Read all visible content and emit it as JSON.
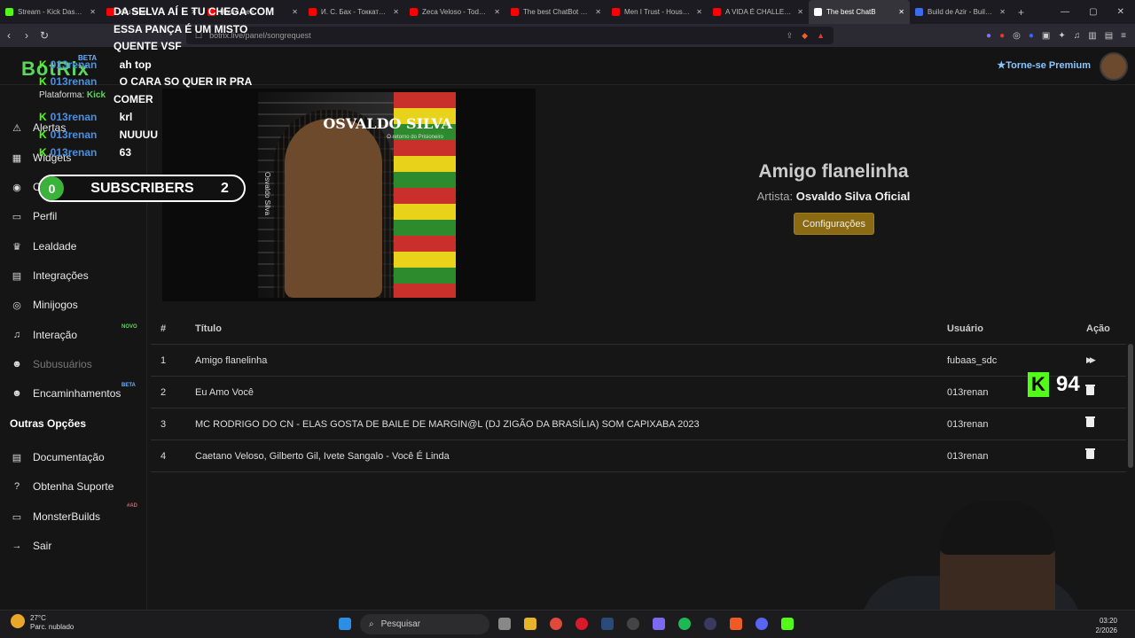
{
  "browser": {
    "tabs": [
      {
        "label": "Stream - Kick Dashbo",
        "color": "#53fc18"
      },
      {
        "label": "YouTube",
        "color": "#ff0000"
      },
      {
        "label": "Hours Dee",
        "color": "#ff0000"
      },
      {
        "label": "И. С. Бах - Токката и ф",
        "color": "#ff0000"
      },
      {
        "label": "Zeca Veloso - Todo Ho",
        "color": "#ff0000"
      },
      {
        "label": "The best ChatBot and",
        "color": "#ff0000"
      },
      {
        "label": "Men I Trust - House Ed",
        "color": "#ff0000"
      },
      {
        "label": "A VIDA É CHALLENGE",
        "color": "#ff0000"
      },
      {
        "label": "The best ChatB",
        "color": "#ffffff",
        "active": true
      },
      {
        "label": "Build de Azir - Builds c",
        "color": "#3b6cf0"
      }
    ],
    "url": "botrix.live/panel/songrequest"
  },
  "header": {
    "logo": "BotRix",
    "logo_badge": "BETA",
    "premium": "Torne-se Premium"
  },
  "sidebar": {
    "platform_label": "Plataforma:",
    "platform_value": "Kick",
    "items": [
      {
        "label": "Alertas",
        "icon": "warning-icon"
      },
      {
        "label": "Widgets",
        "icon": "widgets-icon"
      },
      {
        "label": "Comandos",
        "icon": "robot-icon"
      },
      {
        "label": "Perfil",
        "icon": "profile-icon"
      },
      {
        "label": "Lealdade",
        "icon": "trophy-icon"
      },
      {
        "label": "Integrações",
        "icon": "integrations-icon"
      },
      {
        "label": "Minijogos",
        "icon": "gamepad-icon"
      },
      {
        "label": "Interação",
        "icon": "music-icon",
        "badge": "NOVO"
      },
      {
        "label": "Subusuários",
        "icon": "users-icon",
        "disabled": true
      },
      {
        "label": "Encaminhamentos",
        "icon": "group-icon",
        "badge": "BETA"
      }
    ],
    "section_label": "Outras Opções",
    "other_items": [
      {
        "label": "Documentação",
        "icon": "docs-icon"
      },
      {
        "label": "Obtenha Suporte",
        "icon": "support-icon"
      },
      {
        "label": "MonsterBuilds",
        "icon": "monitor-icon",
        "badge": "#AD"
      },
      {
        "label": "Sair",
        "icon": "logout-icon"
      }
    ]
  },
  "now_playing": {
    "title": "Amigo flanelinha",
    "artist_label": "Artista:",
    "artist": "Osvaldo Silva Oficial",
    "config_button": "Configurações",
    "cover_artist": "OSVALDO SILVA",
    "cover_album": "O retorno do Prisioneiro",
    "cover_vertical": "Osvaldo Silva"
  },
  "queue": {
    "headers": {
      "num": "#",
      "title": "Título",
      "user": "Usuário",
      "action": "Ação"
    },
    "rows": [
      {
        "num": "1",
        "title": "Amigo flanelinha",
        "user": "fubaas_sdc",
        "action": "skip"
      },
      {
        "num": "2",
        "title": "Eu Amo Você",
        "user": "013renan",
        "action": "delete"
      },
      {
        "num": "3",
        "title": "MC RODRIGO DO CN - ELAS GOSTA DE BAILE DE MARGIN@L (DJ ZIGÃO DA BRASÍLIA) SOM CAPIXABA 2023",
        "user": "013renan",
        "action": "delete"
      },
      {
        "num": "4",
        "title": "Caetano Veloso, Gilberto Gil, Ivete Sangalo - Você É Linda",
        "user": "013renan",
        "action": "delete"
      }
    ]
  },
  "overlay": {
    "chat": [
      {
        "user": "",
        "text": "DA SELVA AÍ E TU CHEGA COM"
      },
      {
        "user": "",
        "text": "ESSA PANÇA É UM MISTO"
      },
      {
        "user": "",
        "text": "QUENTE VSF"
      },
      {
        "user": "013renan",
        "text": "ah top"
      },
      {
        "user": "013renan",
        "text": "O CARA SO QUER IR PRA"
      },
      {
        "user": "",
        "text": "COMER"
      },
      {
        "user": "013renan",
        "text": "krl"
      },
      {
        "user": "013renan",
        "text": "NUUUU"
      },
      {
        "user": "013renan",
        "text": "63"
      }
    ],
    "subs_left": "0",
    "subs_label": "SUBSCRIBERS",
    "subs_right": "2",
    "kick_count": "94"
  },
  "taskbar": {
    "temp": "27°C",
    "weather": "Parc. nublado",
    "search_placeholder": "Pesquisar",
    "time": "03:20",
    "date": "2/2026"
  }
}
